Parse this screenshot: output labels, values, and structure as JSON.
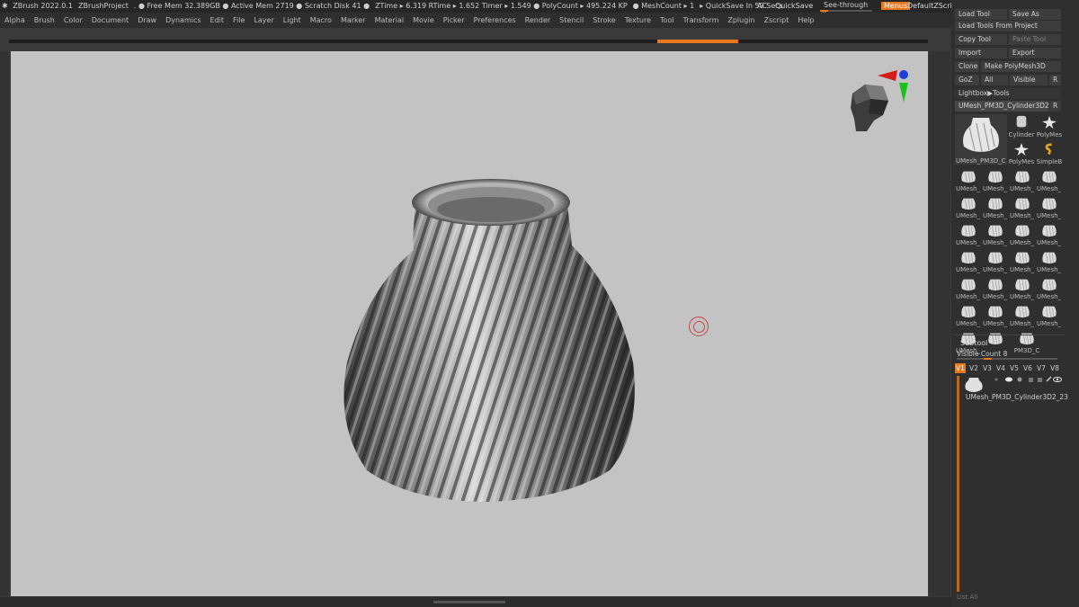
{
  "title_bar": {
    "items": [
      "ZBrush 2022.0.1",
      "ZBrushProject",
      ". ● Free Mem 32.389GB ● Active Mem 2719 ● Scratch Disk 41 ●",
      "ZTime ▸ 6.319 RTime ▸ 1.652 Timer ▸ 1.549 ● PolyCount ▸ 495.224 KP",
      "● MeshCount ▸ 1",
      "▸ QuickSave In 59 Secs"
    ],
    "ac": "AC",
    "quicksave": "QuickSave",
    "see_through_label": "See-through",
    "see_through_value": "0",
    "menus": "Menus",
    "default_script": "DefaultZScript"
  },
  "menu_bar": [
    "Alpha",
    "Brush",
    "Color",
    "Document",
    "Draw",
    "Dynamics",
    "Edit",
    "File",
    "Layer",
    "Light",
    "Macro",
    "Marker",
    "Material",
    "Movie",
    "Picker",
    "Preferences",
    "Render",
    "Stencil",
    "Stroke",
    "Texture",
    "Tool",
    "Transform",
    "Zplugin",
    "Zscript",
    "Help"
  ],
  "tool_panel": {
    "load_tool": "Load Tool",
    "save_as": "Save As",
    "load_from_project": "Load Tools From Project",
    "copy_tool": "Copy Tool",
    "paste_tool": "Paste Tool",
    "import": "Import",
    "export": "Export",
    "clone": "Clone",
    "make_polymesh": "Make PolyMesh3D",
    "goz": "GoZ",
    "all": "All",
    "visible": "Visible",
    "r": "R",
    "lightbox_tools": "Lightbox▶Tools",
    "current_tool": "UMesh_PM3D_Cylinder3D2_2",
    "current_tool_r": "R",
    "big_thumb_label": "UMesh_PM3D_C",
    "side_thumbs": [
      "Cylinder",
      "PolyMes",
      "PolyMes",
      "SimpleB"
    ],
    "grid_thumbs": [
      "UMesh_",
      "UMesh_",
      "UMesh_",
      "UMesh_",
      "UMesh_",
      "UMesh_",
      "UMesh_",
      "UMesh_",
      "UMesh_",
      "UMesh_",
      "UMesh_",
      "UMesh_",
      "UMesh_",
      "UMesh_",
      "UMesh_",
      "UMesh_",
      "UMesh_",
      "UMesh_",
      "UMesh_",
      "UMesh_",
      "UMesh_",
      "UMesh_",
      "UMesh_",
      "UMesh_",
      "UMesh_",
      "",
      "PM3D_C"
    ]
  },
  "subtool": {
    "title": "Subtool",
    "visible_count_label": "Visible Count",
    "visible_count": "8",
    "versions": [
      "V1",
      "V2",
      "V3",
      "V4",
      "V5",
      "V6",
      "V7",
      "V8"
    ],
    "active_version": "V1",
    "item_name": "UMesh_PM3D_Cylinder3D2_23",
    "list_all": "List All"
  },
  "colors": {
    "accent": "#e8781e",
    "viewport_bg": "#c3c3c3",
    "panel_bg": "#2f2f2f"
  }
}
